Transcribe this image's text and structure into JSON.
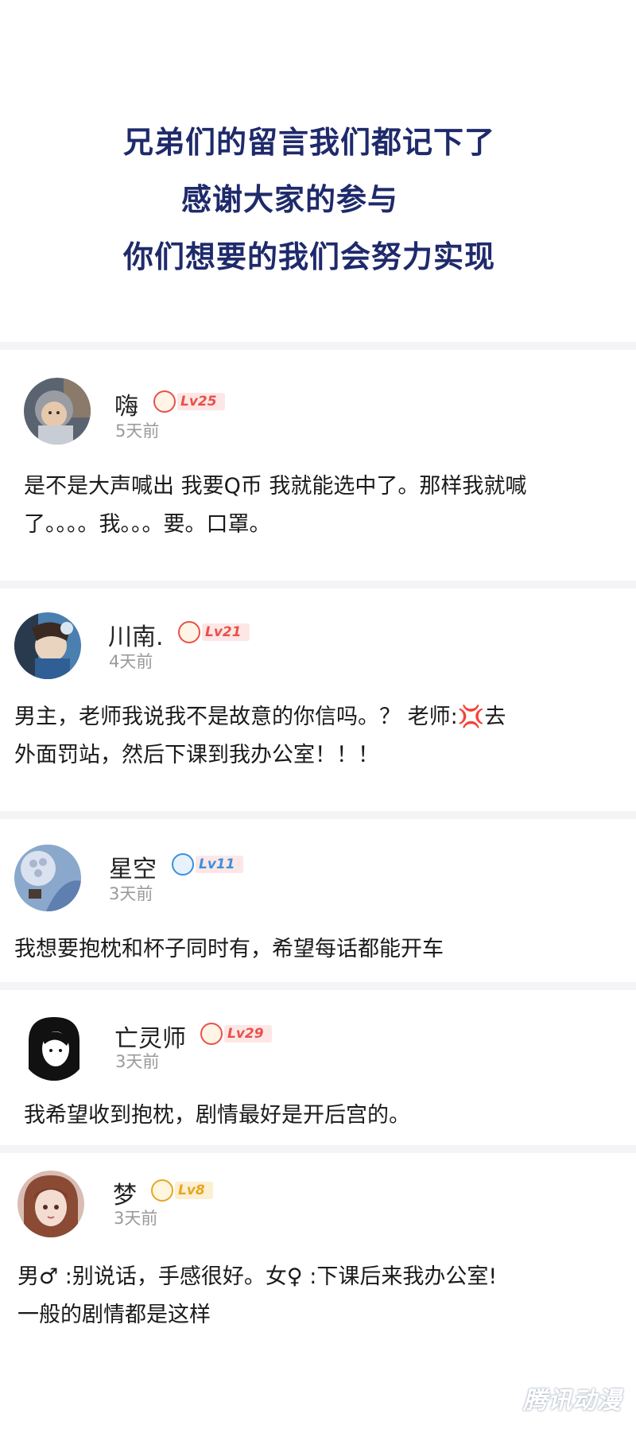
{
  "header": {
    "line1": "兄弟们的留言我们都记下了",
    "line2": "感谢大家的参与",
    "line3": "你们想要的我们会努力实现"
  },
  "comments": [
    {
      "username": "嗨",
      "level": "Lv25",
      "time": "5天前",
      "text_lines": [
        "是不是大声喊出 我要Q币 我就能选中了。那样我就喊",
        "了。。。。我。。。要。口罩。"
      ]
    },
    {
      "username": "川南.",
      "level": "Lv21",
      "time": "4天前",
      "text_line1_a": "男主，老师我说我不是故意的你信吗。？ 老师:",
      "text_line1_emoji": "💢",
      "text_line1_b": "去",
      "text_line2": "外面罚站，然后下课到我办公室！！！"
    },
    {
      "username": "星空",
      "level": "Lv11",
      "time": "3天前",
      "text_lines": [
        "我想要抱枕和杯子同时有，希望每话都能开车"
      ]
    },
    {
      "username": "亡灵师",
      "level": "Lv29",
      "time": "3天前",
      "text_lines": [
        "我希望收到抱枕，剧情最好是开后宫的。"
      ]
    },
    {
      "username": "梦",
      "level": "Lv8",
      "time": "3天前",
      "text_lines": [
        "男♂ :别说话，手感很好。女♀ :下课后来我办公室!",
        "一般的剧情都是这样"
      ]
    }
  ],
  "watermark": "腾讯动漫",
  "colors": {
    "header_text": "#1f2a6b",
    "level_red": "#e8514a",
    "level_blue": "#3a8fe0",
    "level_yellow": "#e7a722",
    "time_gray": "#9a9a9a"
  }
}
